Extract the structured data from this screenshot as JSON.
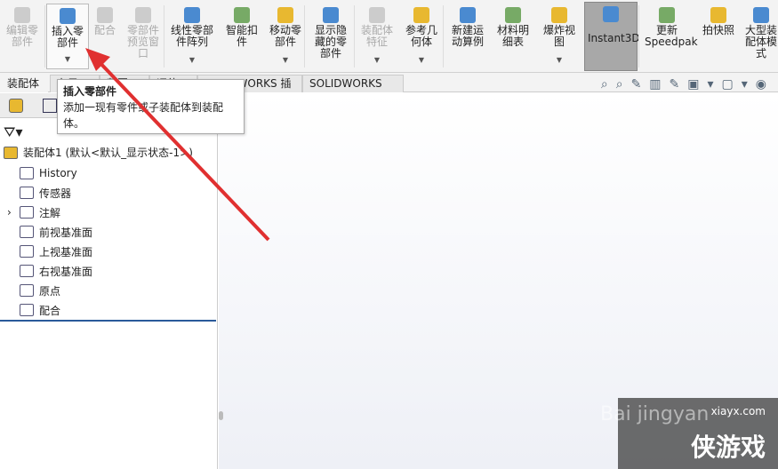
{
  "ribbon": {
    "buttons": [
      {
        "label": "编辑零部件",
        "disabled": true
      },
      {
        "label": "插入零部件",
        "disabled": false
      },
      {
        "label": "配合",
        "disabled": true
      },
      {
        "label": "零部件预览窗口",
        "disabled": true
      },
      {
        "label": "线性零部件阵列",
        "disabled": false
      },
      {
        "label": "智能扣件",
        "disabled": false
      },
      {
        "label": "移动零部件",
        "disabled": false
      },
      {
        "label": "显示隐藏的零部件",
        "disabled": false
      },
      {
        "label": "装配体特征",
        "disabled": true
      },
      {
        "label": "参考几何体",
        "disabled": false
      },
      {
        "label": "新建运动算例",
        "disabled": false
      },
      {
        "label": "材料明细表",
        "disabled": false
      },
      {
        "label": "爆炸视图",
        "disabled": false
      },
      {
        "label": "Instant3D",
        "disabled": false,
        "active": true
      },
      {
        "label": "更新Speedpak",
        "disabled": false
      },
      {
        "label": "拍快照",
        "disabled": false
      },
      {
        "label": "大型装配体模式",
        "disabled": false
      }
    ]
  },
  "tabs": [
    "装配体",
    "布局",
    "草图",
    "评估",
    "SOLIDWORKS 插件",
    "SOLIDWORKS MBD"
  ],
  "tooltip": {
    "title": "插入零部件",
    "body": "添加一现有零件或子装配体到装配体。"
  },
  "tree": {
    "root": "装配体1  (默认<默认_显示状态-1>)",
    "items": [
      "History",
      "传感器",
      "注解",
      "前视基准面",
      "上视基准面",
      "右视基准面",
      "原点",
      "配合"
    ]
  },
  "watermark": {
    "site": "xiayx.com",
    "brand": "侠游戏",
    "baidu": "Bai jingyan"
  },
  "colors": {
    "arrow": "#e03030",
    "active_button": "#a8a8a8"
  }
}
